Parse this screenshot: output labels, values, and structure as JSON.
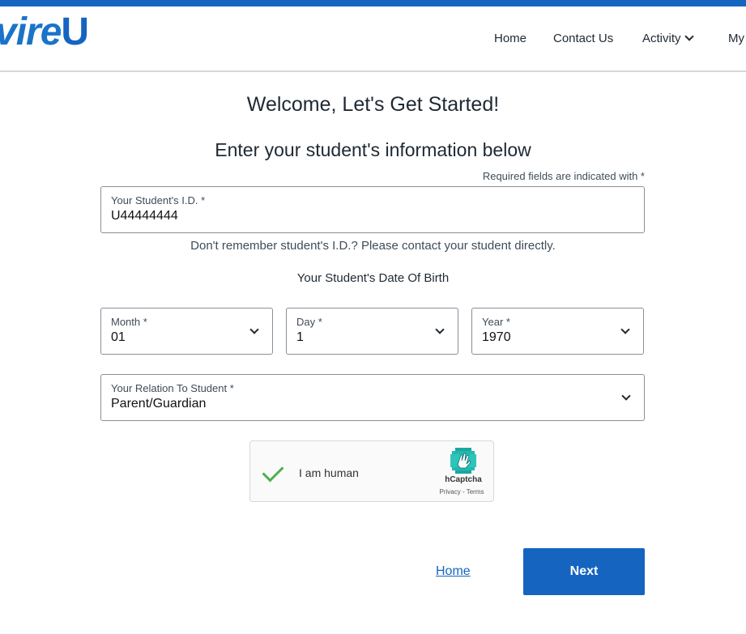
{
  "header": {
    "logo_text": "vire",
    "logo_letter": "U",
    "nav": {
      "home": "Home",
      "contact": "Contact Us",
      "activity": "Activity",
      "my": "My"
    }
  },
  "main": {
    "title": "Welcome, Let's Get Started!",
    "subtitle": "Enter your student's information below",
    "required_note": "Required fields are indicated with *",
    "student_id": {
      "label": "Your Student's I.D. *",
      "value": "U44444444"
    },
    "help_text": "Don't remember student's I.D.? Please contact your student directly.",
    "dob_title": "Your Student's Date Of Birth",
    "month": {
      "label": "Month *",
      "value": "01"
    },
    "day": {
      "label": "Day *",
      "value": "1"
    },
    "year": {
      "label": "Year *",
      "value": "1970"
    },
    "relation": {
      "label": "Your Relation To Student *",
      "value": "Parent/Guardian"
    }
  },
  "captcha": {
    "label": "I am human",
    "brand": "hCaptcha",
    "privacy": "Privacy",
    "separator": " - ",
    "terms": "Terms",
    "checked": true
  },
  "footer": {
    "home_link": "Home",
    "next_label": "Next"
  },
  "colors": {
    "brand_blue": "#1565c0",
    "check_green": "#4caf50"
  },
  "icons": [
    "chevron-down-icon",
    "checkmark-icon",
    "hcaptcha-logo-icon"
  ]
}
